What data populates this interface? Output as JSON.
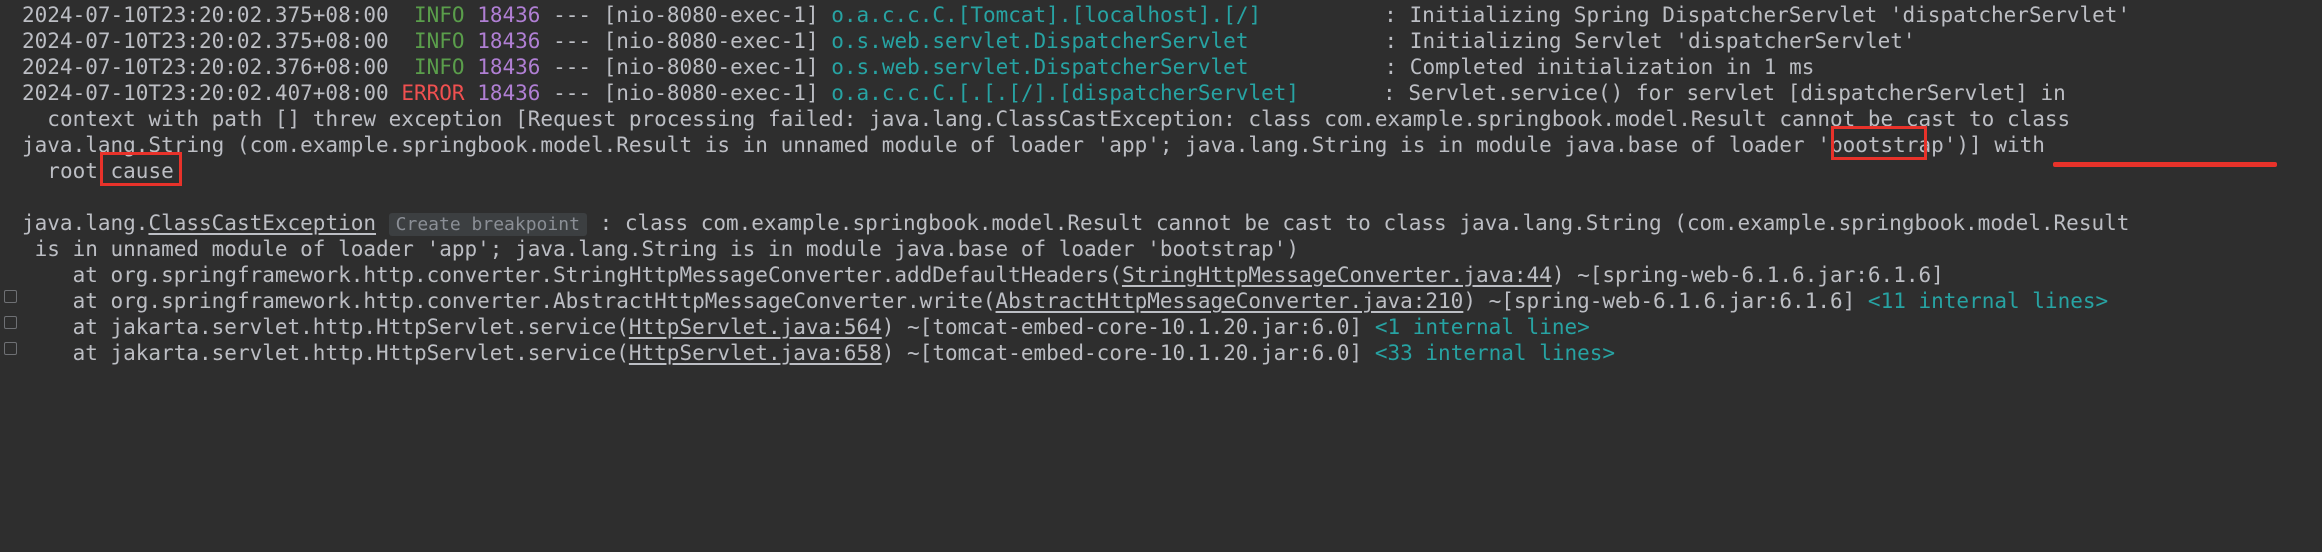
{
  "theme": {
    "background": "#2e2e2e",
    "foreground": "#bcbec4",
    "info_color": "#5a9e4b",
    "error_color": "#f05050",
    "pid_color": "#b07fd4",
    "logger_color": "#27a3a3",
    "fold_marker_color": "#27a3a3",
    "annotation_color": "#e8322a",
    "muted_color": "#8b8f96"
  },
  "log": {
    "lines": [
      {
        "id": "log-line-1",
        "timestamp": "2024-07-10T23:20:02.375+08:00",
        "level": "INFO",
        "pid": "18436",
        "separator": "---",
        "thread": "[nio-8080-exec-1]",
        "logger": "o.a.c.c.C.[Tomcat].[localhost].[/]",
        "colon": ":",
        "message": "Initializing Spring DispatcherServlet 'dispatcherServlet'"
      },
      {
        "id": "log-line-2",
        "timestamp": "2024-07-10T23:20:02.375+08:00",
        "level": "INFO",
        "pid": "18436",
        "separator": "---",
        "thread": "[nio-8080-exec-1]",
        "logger": "o.s.web.servlet.DispatcherServlet",
        "colon": ":",
        "message": "Initializing Servlet 'dispatcherServlet'"
      },
      {
        "id": "log-line-3",
        "timestamp": "2024-07-10T23:20:02.376+08:00",
        "level": "INFO",
        "pid": "18436",
        "separator": "---",
        "thread": "[nio-8080-exec-1]",
        "logger": "o.s.web.servlet.DispatcherServlet",
        "colon": ":",
        "message": "Completed initialization in 1 ms"
      },
      {
        "id": "log-line-4",
        "timestamp": "2024-07-10T23:20:02.407+08:00",
        "level": "ERROR",
        "pid": "18436",
        "separator": "---",
        "thread": "[nio-8080-exec-1]",
        "logger": "o.a.c.c.C.[.[.[/].[dispatcherServlet]",
        "colon": ":",
        "message": "Servlet.service() for servlet [dispatcherServlet] in"
      }
    ],
    "wrapped": {
      "line_2": "context with path [] threw exception [Request processing failed: java.lang.ClassCastException: class com.example.springbook.model.Result cannot be cast to class",
      "line_3": "java.lang.String (com.example.springbook.model.Result is in unnamed module of loader 'app'; java.lang.String is in module java.base of loader 'bootstrap')] with",
      "line_4": "root cause"
    }
  },
  "stacktrace": {
    "header": {
      "package_prefix": "java.lang.",
      "exception_link": "ClassCastException",
      "breakpoint_badge": "Create breakpoint",
      "colon": ":",
      "message": "class com.example.springbook.model.Result cannot be cast to class java.lang.String (com.example.springbook.model.Result",
      "continuation": "is in unnamed module of loader 'app'; java.lang.String is in module java.base of loader 'bootstrap')"
    },
    "frames": [
      {
        "id": "frame-1",
        "prefix": "at org.springframework.http.converter.StringHttpMessageConverter.addDefaultHeaders(",
        "link": "StringHttpMessageConverter.java:44",
        "suffix": ") ~[spring-web-6.1.6.jar:6.1.6]",
        "fold": "",
        "has_gutter_icon": false
      },
      {
        "id": "frame-2",
        "prefix": "at org.springframework.http.converter.AbstractHttpMessageConverter.write(",
        "link": "AbstractHttpMessageConverter.java:210",
        "suffix": ") ~[spring-web-6.1.6.jar:6.1.6]",
        "fold": "<11 internal lines>",
        "has_gutter_icon": true
      },
      {
        "id": "frame-3",
        "prefix": "at jakarta.servlet.http.HttpServlet.service(",
        "link": "HttpServlet.java:564",
        "suffix": ") ~[tomcat-embed-core-10.1.20.jar:6.0]",
        "fold": "<1 internal line>",
        "has_gutter_icon": true
      },
      {
        "id": "frame-4",
        "prefix": "at jakarta.servlet.http.HttpServlet.service(",
        "link": "HttpServlet.java:658",
        "suffix": ") ~[tomcat-embed-core-10.1.20.jar:6.0]",
        "fold": "<33 internal lines>",
        "has_gutter_icon": true
      }
    ]
  },
  "annotations": [
    {
      "id": "anno-result-box",
      "type": "box",
      "label": ".Result"
    },
    {
      "id": "anno-cast-underline",
      "type": "underline",
      "label": "be cast to class"
    },
    {
      "id": "anno-string-box",
      "type": "box",
      "label": "String"
    }
  ]
}
